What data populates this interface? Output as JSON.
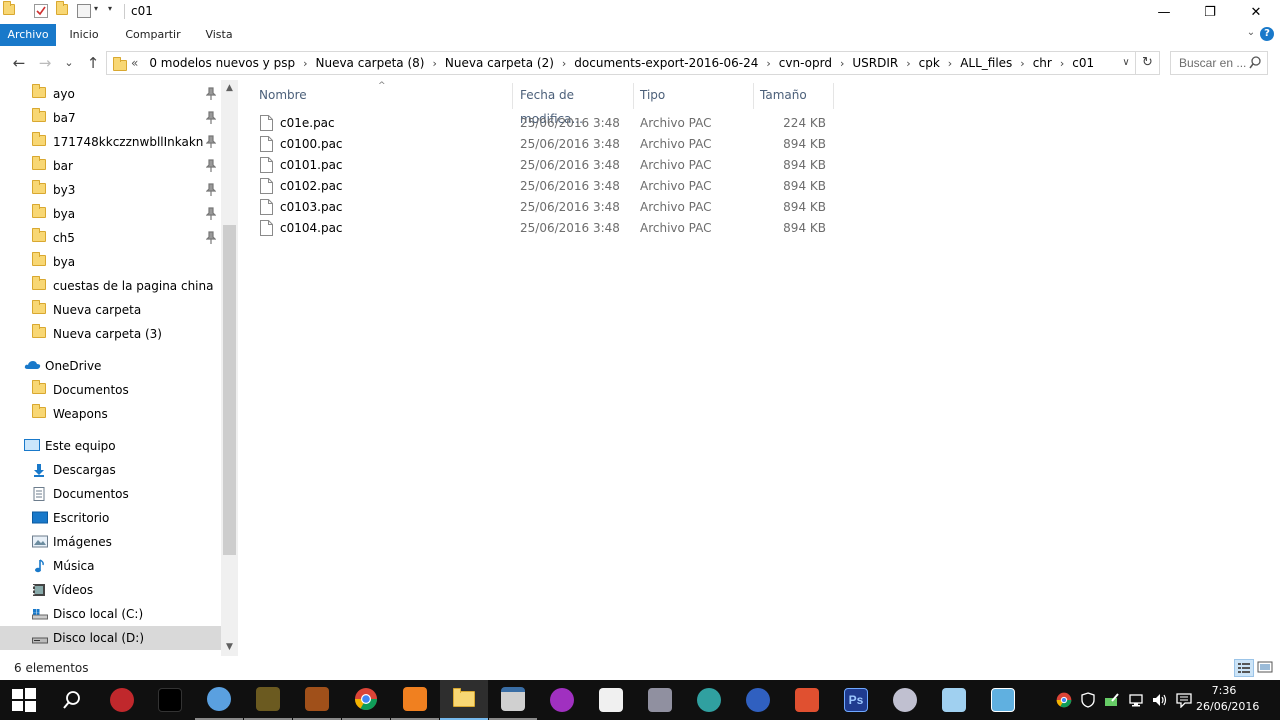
{
  "window": {
    "title": "c01",
    "minimize_glyph": "—",
    "maximize_glyph": "❐",
    "close_glyph": "✕"
  },
  "ribbon": {
    "tabs": [
      {
        "label": "Archivo",
        "active": true
      },
      {
        "label": "Inicio",
        "active": false
      },
      {
        "label": "Compartir",
        "active": false
      },
      {
        "label": "Vista",
        "active": false
      }
    ],
    "help_glyph": "?"
  },
  "nav": {
    "back_glyph": "←",
    "forward_glyph": "→",
    "up_glyph": "↑",
    "recent_glyph": "⌄",
    "lead": "«",
    "breadcrumbs": [
      "0 modelos nuevos y psp",
      "Nueva carpeta (8)",
      "Nueva carpeta (2)",
      "documents-export-2016-06-24",
      "cvn-oprd",
      "USRDIR",
      "cpk",
      "ALL_files",
      "chr",
      "c01"
    ],
    "separator": "›",
    "dropdown_glyph": "∨",
    "refresh_glyph": "↻",
    "search_placeholder": "Buscar en ..."
  },
  "sidebar": {
    "quick_access": [
      {
        "label": "ayo",
        "pinned": true
      },
      {
        "label": "ba7",
        "pinned": true
      },
      {
        "label": "171748kkczznwbllInkakn",
        "pinned": true
      },
      {
        "label": "bar",
        "pinned": true
      },
      {
        "label": "by3",
        "pinned": true
      },
      {
        "label": "bya",
        "pinned": true
      },
      {
        "label": "ch5",
        "pinned": true
      },
      {
        "label": "bya",
        "pinned": false
      },
      {
        "label": "cuestas de la pagina china",
        "pinned": false
      },
      {
        "label": "Nueva carpeta",
        "pinned": false
      },
      {
        "label": "Nueva carpeta (3)",
        "pinned": false
      }
    ],
    "onedrive": {
      "label": "OneDrive",
      "items": [
        "Documentos",
        "Weapons"
      ]
    },
    "this_pc": {
      "label": "Este equipo",
      "items": [
        {
          "label": "Descargas",
          "icon": "download-icon"
        },
        {
          "label": "Documentos",
          "icon": "documents-icon"
        },
        {
          "label": "Escritorio",
          "icon": "desktop-icon"
        },
        {
          "label": "Imágenes",
          "icon": "pictures-icon"
        },
        {
          "label": "Música",
          "icon": "music-icon"
        },
        {
          "label": "Vídeos",
          "icon": "videos-icon"
        },
        {
          "label": "Disco local (C:)",
          "icon": "drive-c-icon"
        },
        {
          "label": "Disco local (D:)",
          "icon": "drive-d-icon",
          "selected": true
        }
      ]
    },
    "scroll_up_glyph": "▲",
    "scroll_down_glyph": "▼"
  },
  "columns": {
    "name": "Nombre",
    "date": "Fecha de modifica...",
    "type": "Tipo",
    "size": "Tamaño",
    "sort_glyph": "^"
  },
  "files": [
    {
      "name": "c01e.pac",
      "date": "25/06/2016 3:48",
      "type": "Archivo PAC",
      "size": "224 KB"
    },
    {
      "name": "c0100.pac",
      "date": "25/06/2016 3:48",
      "type": "Archivo PAC",
      "size": "894 KB"
    },
    {
      "name": "c0101.pac",
      "date": "25/06/2016 3:48",
      "type": "Archivo PAC",
      "size": "894 KB"
    },
    {
      "name": "c0102.pac",
      "date": "25/06/2016 3:48",
      "type": "Archivo PAC",
      "size": "894 KB"
    },
    {
      "name": "c0103.pac",
      "date": "25/06/2016 3:48",
      "type": "Archivo PAC",
      "size": "894 KB"
    },
    {
      "name": "c0104.pac",
      "date": "25/06/2016 3:48",
      "type": "Archivo PAC",
      "size": "894 KB"
    }
  ],
  "status": {
    "count": "6 elementos"
  },
  "taskbar": {
    "clock_time": "7:36",
    "clock_date": "26/06/2016",
    "apps": [
      {
        "name": "start-icon",
        "color": "#ffffff"
      },
      {
        "name": "search-icon",
        "color": "#ffffff"
      },
      {
        "name": "app-red-circle-icon",
        "color": "#c0282c"
      },
      {
        "name": "app-black-square-icon",
        "color": "#000000"
      },
      {
        "name": "paint-icon",
        "color": "#5aa0e0"
      },
      {
        "name": "game-emblem-icon",
        "color": "#6b5a20"
      },
      {
        "name": "game-character-icon",
        "color": "#a0501a"
      },
      {
        "name": "chrome-icon",
        "color": "#e8a020"
      },
      {
        "name": "media-player-icon",
        "color": "#f08020"
      },
      {
        "name": "file-explorer-icon",
        "color": "#f8d774"
      },
      {
        "name": "window-app-icon",
        "color": "#d0d0d0"
      },
      {
        "name": "purple-app-icon",
        "color": "#a030c0"
      },
      {
        "name": "white-box-icon",
        "color": "#f0f0f0"
      },
      {
        "name": "gamecube-icon",
        "color": "#9090a0"
      },
      {
        "name": "plane-icon",
        "color": "#30a0a0"
      },
      {
        "name": "cinema4d-icon",
        "color": "#3060c0"
      },
      {
        "name": "colored-blocks-icon",
        "color": "#e05030"
      },
      {
        "name": "photoshop-icon",
        "color": "#1f3b8f"
      },
      {
        "name": "ring-app-icon",
        "color": "#c0c0d0"
      },
      {
        "name": "note-app-icon",
        "color": "#a0d0f0"
      },
      {
        "name": "image-viewer-icon",
        "color": "#60b0e0"
      }
    ],
    "tray": [
      "chrome-tray-icon",
      "shield-tray-icon",
      "edit-tray-icon",
      "battery-tray-icon",
      "network-tray-icon",
      "volume-tray-icon",
      "notifications-tray-icon"
    ]
  }
}
